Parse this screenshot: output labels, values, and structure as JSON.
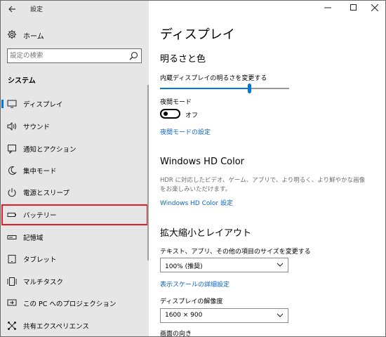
{
  "app": {
    "title": "設定"
  },
  "sidebar": {
    "home_label": "ホーム",
    "search_placeholder": "設定の検索",
    "section_title": "システム",
    "items": [
      {
        "label": "ディスプレイ",
        "icon": "monitor-icon"
      },
      {
        "label": "サウンド",
        "icon": "speaker-icon"
      },
      {
        "label": "通知とアクション",
        "icon": "notification-icon"
      },
      {
        "label": "集中モード",
        "icon": "moon-icon"
      },
      {
        "label": "電源とスリープ",
        "icon": "power-icon"
      },
      {
        "label": "バッテリー",
        "icon": "battery-icon"
      },
      {
        "label": "記憶域",
        "icon": "storage-icon"
      },
      {
        "label": "タブレット",
        "icon": "tablet-icon"
      },
      {
        "label": "マルチタスク",
        "icon": "multitask-icon"
      },
      {
        "label": "この PC へのプロジェクション",
        "icon": "projection-icon"
      },
      {
        "label": "共有エクスペリエンス",
        "icon": "shared-icon"
      }
    ]
  },
  "content": {
    "page_title": "ディスプレイ",
    "brightness": {
      "section_title": "明るさと色",
      "slider_label": "内蔵ディスプレイの明るさを変更する",
      "level": 0.69
    },
    "night_light": {
      "label": "夜間モード",
      "state_label": "オフ",
      "settings_link": "夜間モードの設定"
    },
    "hdr": {
      "section_title": "Windows HD Color",
      "description": "HDR に対応したビデオ、ゲーム、アプリで、より明るく、より鮮やかな画像をお楽しみいただけます。",
      "link": "Windows HD Color 設定"
    },
    "scale": {
      "section_title": "拡大縮小とレイアウト",
      "size_label": "テキスト、アプリ、その他の項目のサイズを変更する",
      "size_value": "100% (推奨)",
      "advanced_link": "表示スケールの詳細設定",
      "resolution_label": "ディスプレイの解像度",
      "resolution_value": "1600 × 900",
      "orientation_label": "画面の向き"
    }
  },
  "colors": {
    "accent": "#0078d7",
    "highlight": "#e51c23",
    "sidebar_bg": "#e6e6e6"
  }
}
